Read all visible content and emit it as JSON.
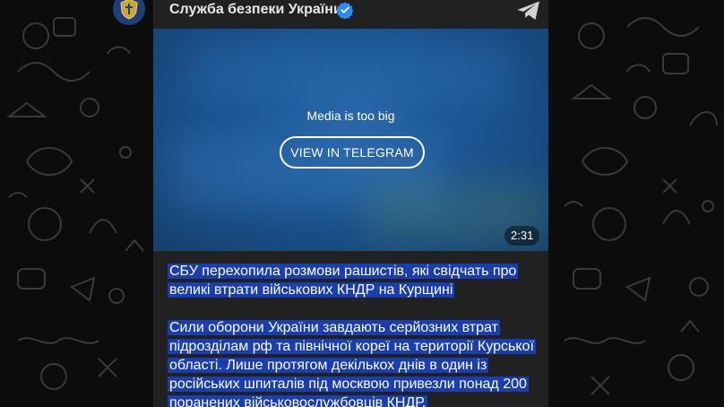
{
  "channel": {
    "name": "Служба безпеки України",
    "verified": true,
    "avatar_icon": "sbu-emblem-icon",
    "accent": "#2a8cf0"
  },
  "media": {
    "message": "Media is too big",
    "button_label": "VIEW IN TELEGRAM",
    "duration": "2:31"
  },
  "post": {
    "headline_lines": [
      "СБУ перехопила розмови рашистів, які свідчать про",
      "великі втрати військових КНДР на Курщині"
    ],
    "body_lines": [
      "Сили оборони України завдають серйозних втрат",
      "підрозділам рф та північної кореї на території Курської",
      "області. Лише протягом декількох днів в один із",
      "російських шпиталів під москвою привезли понад 200",
      "поранених військовослужбовців КНДР."
    ]
  },
  "colors": {
    "background": "#0c0c0c",
    "post_bg": "#212121",
    "text_highlight": "#1a3eb0"
  }
}
